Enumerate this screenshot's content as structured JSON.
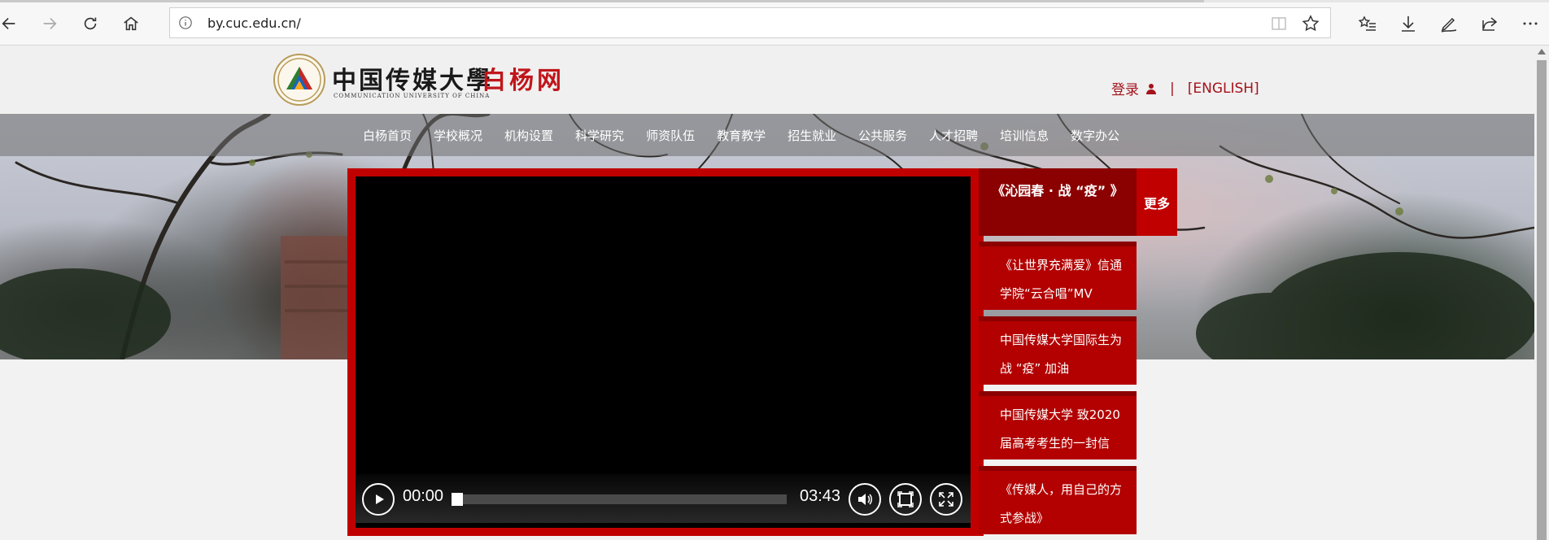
{
  "browser": {
    "url": "by.cuc.edu.cn/"
  },
  "header": {
    "logo_cn": "中国传媒大學",
    "logo_en": "COMMUNICATION UNIVERSITY OF CHINA",
    "site_name": "白杨网",
    "login_label": "登录",
    "separator": "|",
    "english_label": "[ENGLISH]"
  },
  "nav": {
    "items": [
      "白杨首页",
      "学校概况",
      "机构设置",
      "科学研究",
      "师资队伍",
      "教育教学",
      "招生就业",
      "公共服务",
      "人才招聘",
      "培训信息",
      "数字办公"
    ]
  },
  "video": {
    "current_time": "00:00",
    "duration": "03:43",
    "progress": 0
  },
  "side": {
    "head_title": "《沁园春 · 战 “疫” 》",
    "more_label": "更多",
    "items": [
      "《让世界充满爱》信通学院“云合唱”MV",
      "中国传媒大学国际生为战 “疫” 加油",
      "中国传媒大学 致2020届高考考生的一封信",
      "《传媒人，用自己的方式参战》"
    ]
  },
  "colors": {
    "brand_red": "#c00000",
    "dark_red": "#8b0000",
    "link_red": "#a5121b"
  }
}
